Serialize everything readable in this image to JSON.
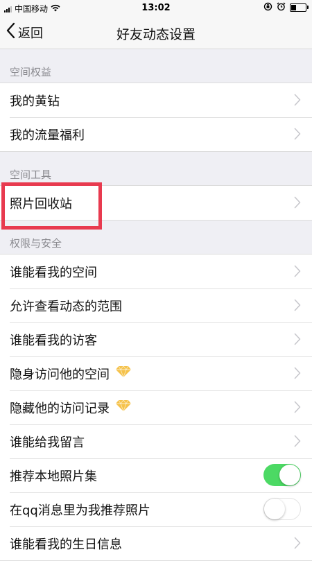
{
  "status": {
    "carrier": "中国移动",
    "time": "13:02"
  },
  "nav": {
    "back_label": "返回",
    "title": "好友动态设置"
  },
  "sections": [
    {
      "header": "空间权益",
      "items": [
        {
          "label": "我的黄钻",
          "control": "chevron"
        },
        {
          "label": "我的流量福利",
          "control": "chevron"
        }
      ]
    },
    {
      "header": "空间工具",
      "items": [
        {
          "label": "照片回收站",
          "control": "chevron"
        }
      ]
    },
    {
      "header": "权限与安全",
      "items": [
        {
          "label": "谁能看我的空间",
          "control": "chevron"
        },
        {
          "label": "允许查看动态的范围",
          "control": "chevron"
        },
        {
          "label": "谁能看我的访客",
          "control": "chevron"
        },
        {
          "label": "隐身访问他的空间",
          "control": "chevron",
          "badge": "diamond-icon"
        },
        {
          "label": "隐藏他的访问记录",
          "control": "chevron",
          "badge": "diamond-icon"
        },
        {
          "label": "谁能给我留言",
          "control": "chevron"
        },
        {
          "label": "推荐本地照片集",
          "control": "toggle",
          "toggle_on": true
        },
        {
          "label": "在qq消息里为我推荐照片",
          "control": "toggle",
          "toggle_on": false
        },
        {
          "label": "谁能看我的生日信息",
          "control": "chevron"
        }
      ]
    }
  ],
  "colors": {
    "toggle_on": "#4cd964",
    "highlight": "#e83a4f",
    "background": "#efeff4"
  }
}
